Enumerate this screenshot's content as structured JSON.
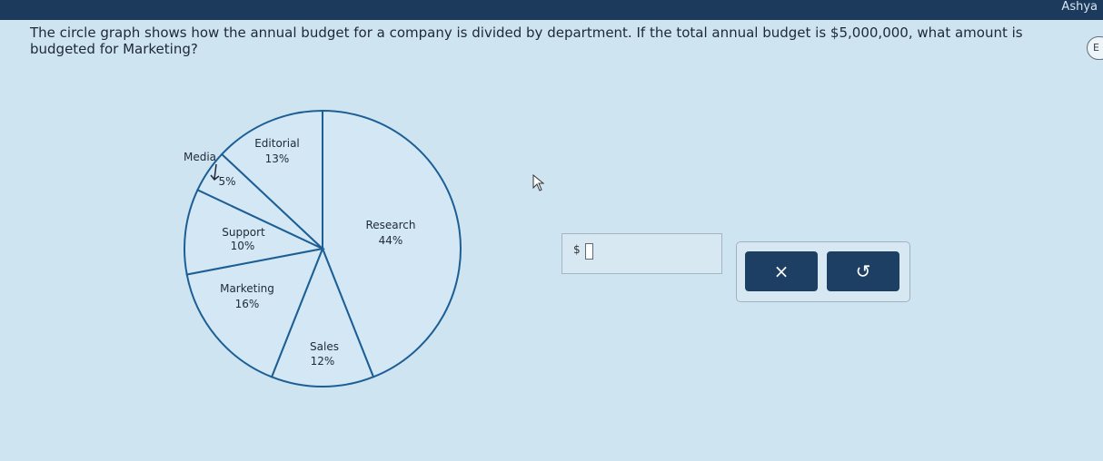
{
  "header": {
    "user_name": "Ashya"
  },
  "question": {
    "text": "The circle graph shows how the annual budget for a company is divided by department. If the total annual budget is $5,000,000, what amount is budgeted for Marketing?"
  },
  "corner_button": {
    "label": "E"
  },
  "answer": {
    "prefix": "$",
    "value": ""
  },
  "buttons": {
    "clear_label": "×",
    "undo_label": "↺"
  },
  "chart_data": {
    "type": "pie",
    "title": "",
    "slices": [
      {
        "name": "Research",
        "value": 44,
        "label": "44%"
      },
      {
        "name": "Sales",
        "value": 12,
        "label": "12%"
      },
      {
        "name": "Marketing",
        "value": 16,
        "label": "16%"
      },
      {
        "name": "Support",
        "value": 10,
        "label": "10%"
      },
      {
        "name": "Media",
        "value": 5,
        "label": "5%"
      },
      {
        "name": "Editorial",
        "value": 13,
        "label": "13%"
      }
    ],
    "colors": {
      "stroke": "#1d5f95",
      "fill": "#d3e7f4"
    }
  }
}
